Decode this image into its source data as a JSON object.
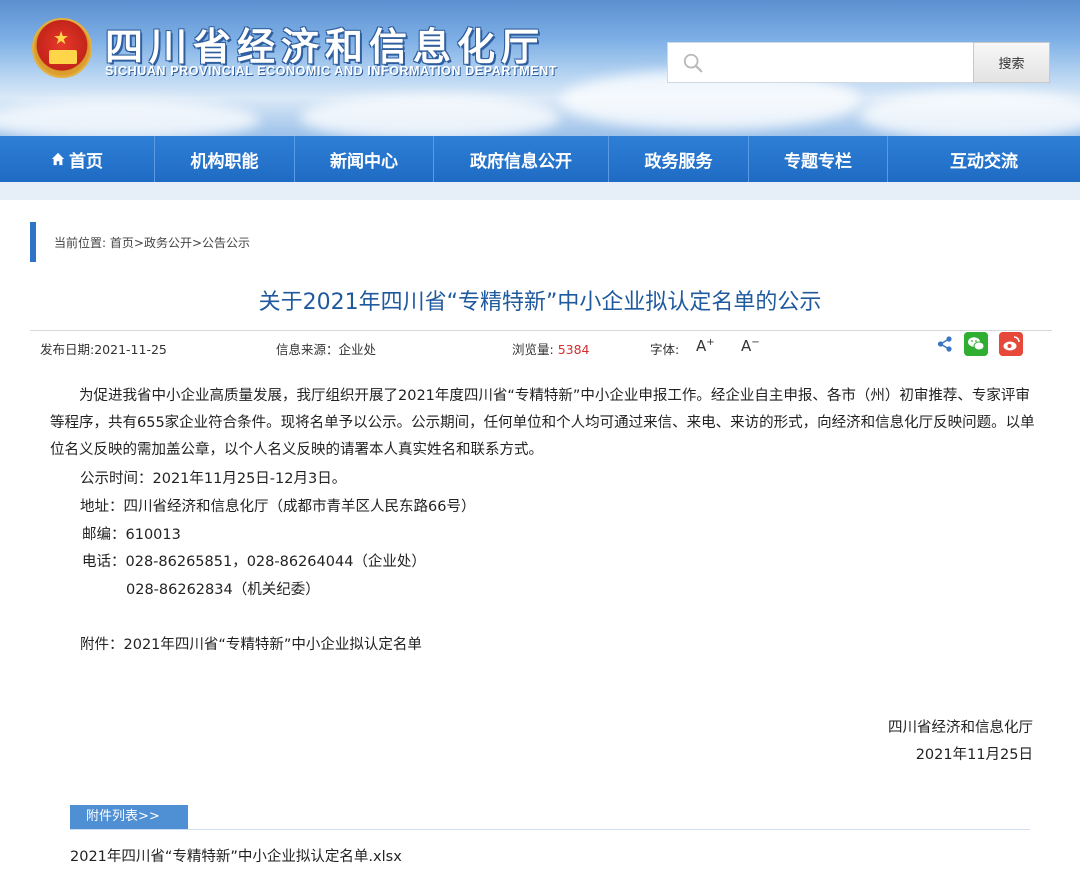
{
  "header": {
    "title": "四川省经济和信息化厅",
    "subtitle": "SICHUAN PROVINCIAL ECONOMIC AND INFORMATION DEPARTMENT",
    "search": {
      "placeholder": "",
      "button_label": "搜索"
    }
  },
  "nav": {
    "items": [
      {
        "label": "首页"
      },
      {
        "label": "机构职能"
      },
      {
        "label": "新闻中心"
      },
      {
        "label": "政府信息公开"
      },
      {
        "label": "政务服务"
      },
      {
        "label": "专题专栏"
      },
      {
        "label": "互动交流"
      }
    ]
  },
  "breadcrumb": {
    "prefix": "当前位置:",
    "items": [
      "首页",
      "政务公开",
      "公告公示"
    ],
    "separator": ">"
  },
  "article": {
    "title": "关于2021年四川省“专精特新”中小企业拟认定名单的公示",
    "meta": {
      "date_label": "发布日期:",
      "date": "2021-11-25",
      "source_label": "信息来源：",
      "source": "企业处",
      "views_label": "浏览量:",
      "views": "5384",
      "font_label": "字体:",
      "font_increase": "A",
      "font_decrease": "A"
    },
    "paragraph": "为促进我省中小企业高质量发展，我厅组织开展了2021年度四川省“专精特新”中小企业申报工作。经企业自主申报、各市（州）初审推荐、专家评审等程序，共有655家企业符合条件。现将名单予以公示。公示期间，任何单位和个人均可通过来信、来电、来访的形式，向经济和信息化厅反映问题。以单位名义反映的需加盖公章，以个人名义反映的请署本人真实姓名和联系方式。",
    "period": "公示时间：2021年11月25日-12月3日。",
    "address": "地址：四川省经济和信息化厅（成都市青羊区人民东路66号）",
    "postcode": "邮编：610013",
    "phone1": "电话：028-86265851，028-86264044（企业处）",
    "phone2": "028-86262834（机关纪委）",
    "attachment_line": "附件：2021年四川省“专精特新”中小企业拟认定名单",
    "signature_org": "四川省经济和信息化厅",
    "signature_date": "2021年11月25日"
  },
  "attachments": {
    "tab_label": "附件列表>>",
    "files": [
      "2021年四川省“专精特新”中小企业拟认定名单.xlsx"
    ]
  },
  "colors": {
    "nav_blue": "#1f6bc4",
    "title_blue": "#1f5a9e",
    "views_red": "#d32f2f",
    "wechat_green": "#2fae32",
    "weibo_red": "#e6483a"
  }
}
